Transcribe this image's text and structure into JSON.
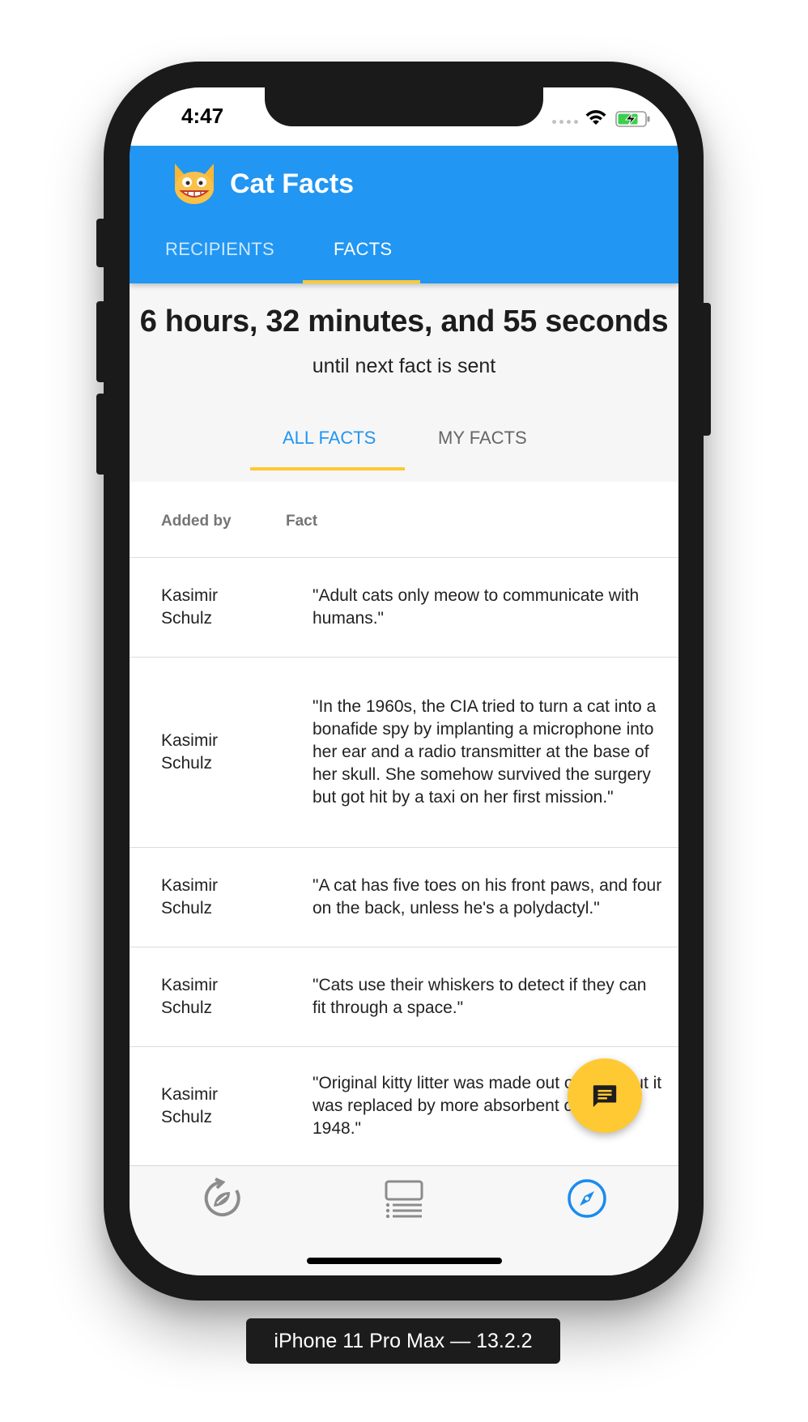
{
  "status_bar": {
    "time": "4:47"
  },
  "app": {
    "title": "Cat Facts"
  },
  "top_tabs": [
    {
      "label": "RECIPIENTS",
      "active": false
    },
    {
      "label": "FACTS",
      "active": true
    }
  ],
  "countdown": {
    "value": "6 hours, 32 minutes, and 55 seconds",
    "caption": "until next fact is sent"
  },
  "sub_tabs": [
    {
      "label": "ALL FACTS",
      "active": true
    },
    {
      "label": "MY FACTS",
      "active": false
    }
  ],
  "table": {
    "headers": {
      "added_by": "Added by",
      "fact": "Fact"
    },
    "rows": [
      {
        "added_by": "Kasimir Schulz",
        "fact": "\"Adult cats only meow to communicate with humans.\""
      },
      {
        "added_by": "Kasimir Schulz",
        "fact": "\"In the 1960s, the CIA tried to turn a cat into a bonafide spy by implanting a microphone into her ear and a radio transmitter at the base of her skull. She somehow survived the surgery but got hit by a taxi on her first mission.\""
      },
      {
        "added_by": "Kasimir Schulz",
        "fact": "\"A cat has five toes on his front paws, and four on the back, unless he's a polydactyl.\""
      },
      {
        "added_by": "Kasimir Schulz",
        "fact": "\"Cats use their whiskers to detect if they can fit through a space.\""
      },
      {
        "added_by": "Kasimir Schulz",
        "fact": "\"Original kitty litter was made out of sand but it was replaced by more absorbent clay in 1948.\""
      }
    ]
  },
  "bottom_nav": [
    {
      "icon": "refresh-leaf-icon",
      "active": false
    },
    {
      "icon": "list-icon",
      "active": false
    },
    {
      "icon": "compass-icon",
      "active": true
    }
  ],
  "fab": {
    "icon": "message-icon"
  },
  "device_label": "iPhone 11 Pro Max — 13.2.2",
  "colors": {
    "primary": "#2196f3",
    "accent": "#ffc933",
    "text": "#222222"
  }
}
